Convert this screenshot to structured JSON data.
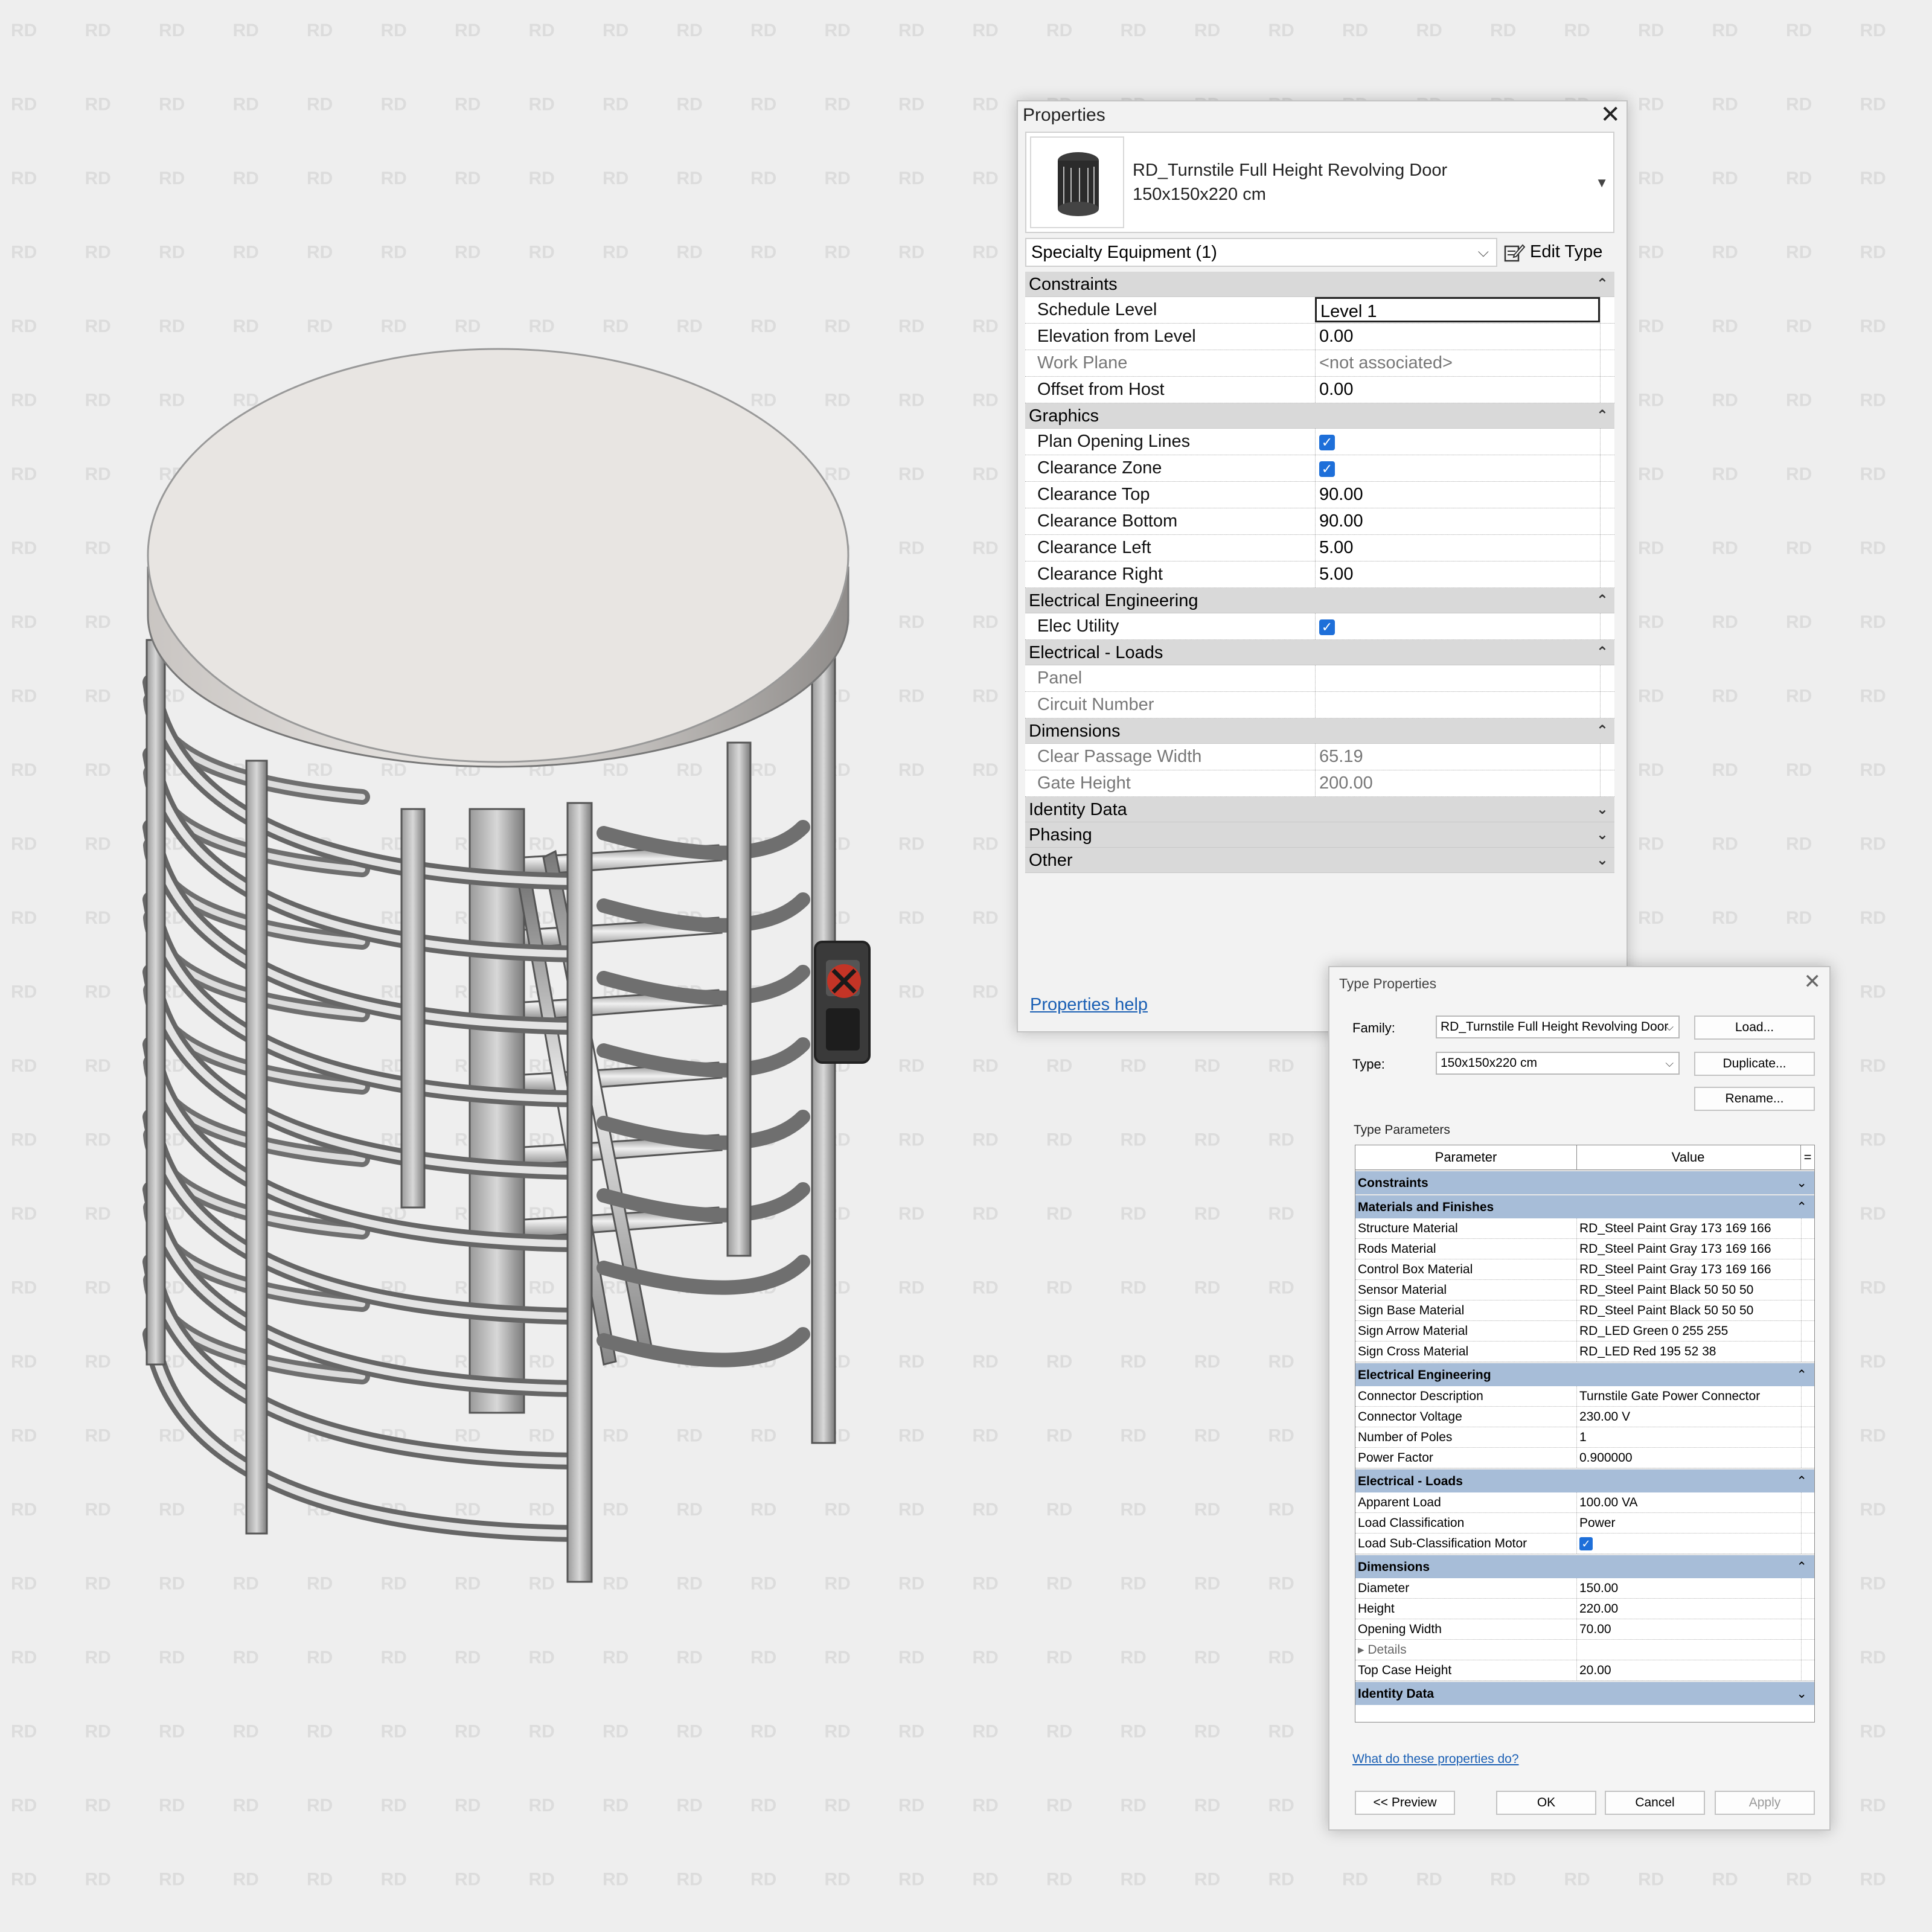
{
  "watermark": "RD",
  "properties": {
    "title": "Properties",
    "close_glyph": "✕",
    "type_name_line1": "RD_Turnstile Full Height Revolving Door",
    "type_name_line2": "150x150x220 cm",
    "category": "Specialty Equipment (1)",
    "edit_type_label": "Edit Type",
    "help_link": "Properties help",
    "sections": [
      {
        "title": "Constraints",
        "collapsed": false,
        "rows": [
          {
            "label": "Schedule Level",
            "value": "Level 1",
            "active": true
          },
          {
            "label": "Elevation from Level",
            "value": "0.00"
          },
          {
            "label": "Work Plane",
            "value": "<not associated>",
            "disabled": true
          },
          {
            "label": "Offset from Host",
            "value": "0.00"
          }
        ]
      },
      {
        "title": "Graphics",
        "collapsed": false,
        "rows": [
          {
            "label": "Plan Opening Lines",
            "checked": true
          },
          {
            "label": "Clearance Zone",
            "checked": true
          },
          {
            "label": "Clearance Top",
            "value": "90.00"
          },
          {
            "label": "Clearance Bottom",
            "value": "90.00"
          },
          {
            "label": "Clearance Left",
            "value": "5.00"
          },
          {
            "label": "Clearance Right",
            "value": "5.00"
          }
        ]
      },
      {
        "title": "Electrical Engineering",
        "collapsed": false,
        "rows": [
          {
            "label": "Elec Utility",
            "checked": true
          }
        ]
      },
      {
        "title": "Electrical - Loads",
        "collapsed": false,
        "rows": [
          {
            "label": "Panel",
            "value": "",
            "disabled": true
          },
          {
            "label": "Circuit Number",
            "value": "",
            "disabled": true
          }
        ]
      },
      {
        "title": "Dimensions",
        "collapsed": false,
        "rows": [
          {
            "label": "Clear Passage Width",
            "value": "65.19",
            "disabled": true
          },
          {
            "label": "Gate Height",
            "value": "200.00",
            "disabled": true
          }
        ]
      },
      {
        "title": "Identity Data",
        "collapsed": true,
        "rows": []
      },
      {
        "title": "Phasing",
        "collapsed": true,
        "rows": []
      },
      {
        "title": "Other",
        "collapsed": true,
        "rows": []
      }
    ]
  },
  "type_properties": {
    "title": "Type Properties",
    "close_glyph": "✕",
    "family_label": "Family:",
    "family_value": "RD_Turnstile Full Height Revolving Door",
    "type_label": "Type:",
    "type_value": "150x150x220 cm",
    "load_btn": "Load...",
    "duplicate_btn": "Duplicate...",
    "rename_btn": "Rename...",
    "params_heading": "Type Parameters",
    "col_param": "Parameter",
    "col_value": "Value",
    "col_eq": "=",
    "sections": [
      {
        "title": "Constraints",
        "collapsed": true,
        "rows": []
      },
      {
        "title": "Materials and Finishes",
        "collapsed": false,
        "rows": [
          {
            "p": "Structure Material",
            "v": "RD_Steel Paint Gray 173 169 166"
          },
          {
            "p": "Rods Material",
            "v": "RD_Steel Paint Gray 173 169 166"
          },
          {
            "p": "Control Box Material",
            "v": "RD_Steel Paint Gray 173 169 166"
          },
          {
            "p": "Sensor Material",
            "v": "RD_Steel Paint Black 50 50 50"
          },
          {
            "p": "Sign Base Material",
            "v": "RD_Steel Paint Black 50 50 50"
          },
          {
            "p": "Sign Arrow Material",
            "v": "RD_LED Green 0 255 255"
          },
          {
            "p": "Sign Cross Material",
            "v": "RD_LED Red 195 52 38"
          }
        ]
      },
      {
        "title": "Electrical Engineering",
        "collapsed": false,
        "rows": [
          {
            "p": "Connector Description",
            "v": "Turnstile Gate Power Connector"
          },
          {
            "p": "Connector Voltage",
            "v": "230.00 V"
          },
          {
            "p": "Number of Poles",
            "v": "1"
          },
          {
            "p": "Power Factor",
            "v": "0.900000"
          }
        ]
      },
      {
        "title": "Electrical - Loads",
        "collapsed": false,
        "rows": [
          {
            "p": "Apparent Load",
            "v": "100.00 VA"
          },
          {
            "p": "Load Classification",
            "v": "Power"
          },
          {
            "p": "Load Sub-Classification Motor",
            "checked": true
          }
        ]
      },
      {
        "title": "Dimensions",
        "collapsed": false,
        "rows": [
          {
            "p": "Diameter",
            "v": "150.00"
          },
          {
            "p": "Height",
            "v": "220.00"
          },
          {
            "p": "Opening Width",
            "v": "70.00"
          },
          {
            "p": "▸ Details",
            "v": "",
            "sub": true
          },
          {
            "p": "Top Case Height",
            "v": "20.00"
          }
        ]
      },
      {
        "title": "Identity Data",
        "collapsed": true,
        "rows": []
      }
    ],
    "help_link": "What do these properties do?",
    "preview_btn": "<< Preview",
    "ok_btn": "OK",
    "cancel_btn": "Cancel",
    "apply_btn": "Apply"
  },
  "colors": {
    "section_blue": "#a7bdd8",
    "link": "#1a5fb4",
    "check": "#1e6fd9",
    "sign_red": "#c33426"
  },
  "icons": [
    "close-icon",
    "dropdown-arrow-icon",
    "edit-type-icon",
    "collapse-chevron-icon",
    "expand-chevron-icon",
    "checkbox-icon",
    "turnstile-thumbnail-icon"
  ]
}
